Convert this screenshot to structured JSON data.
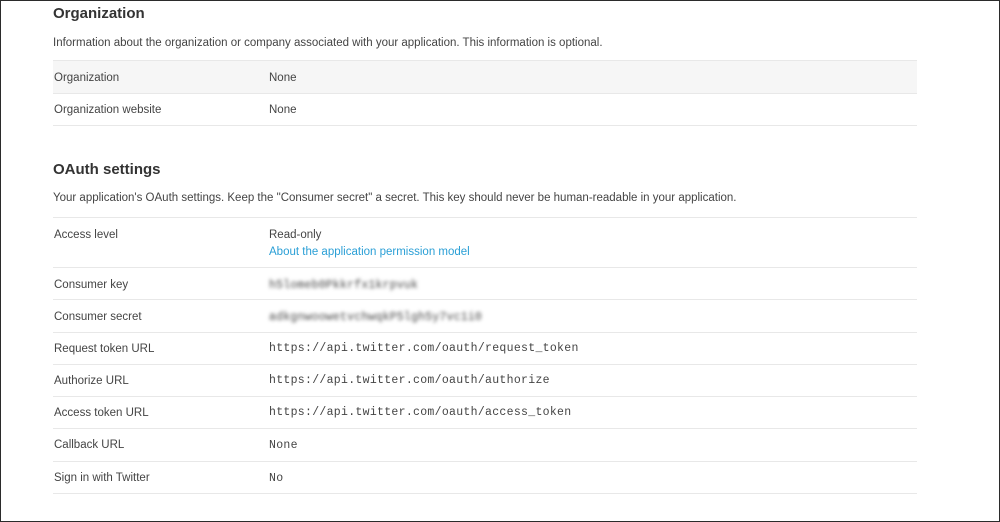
{
  "organization": {
    "title": "Organization",
    "description": "Information about the organization or company associated with your application. This information is optional.",
    "rows": [
      {
        "label": "Organization",
        "value": "None"
      },
      {
        "label": "Organization website",
        "value": "None"
      }
    ]
  },
  "oauth": {
    "title": "OAuth settings",
    "description": "Your application's OAuth settings. Keep the \"Consumer secret\" a secret. This key should never be human-readable in your application.",
    "access_level": {
      "label": "Access level",
      "value": "Read-only",
      "link": "About the application permission model"
    },
    "consumer_key": {
      "label": "Consumer key",
      "value": "h5lomeb0Pkkrfx1krpvuk"
    },
    "consumer_secret": {
      "label": "Consumer secret",
      "value": "adkgnwoowetvchwqkP5lgh5y7vc1i0"
    },
    "request_token_url": {
      "label": "Request token URL",
      "value": "https://api.twitter.com/oauth/request_token"
    },
    "authorize_url": {
      "label": "Authorize URL",
      "value": "https://api.twitter.com/oauth/authorize"
    },
    "access_token_url": {
      "label": "Access token URL",
      "value": "https://api.twitter.com/oauth/access_token"
    },
    "callback_url": {
      "label": "Callback URL",
      "value": "None"
    },
    "sign_in_with_twitter": {
      "label": "Sign in with Twitter",
      "value": "No"
    }
  },
  "colors": {
    "link": "#2a9fd6",
    "border": "#e8e8e8",
    "shaded_row": "#f6f6f6"
  }
}
